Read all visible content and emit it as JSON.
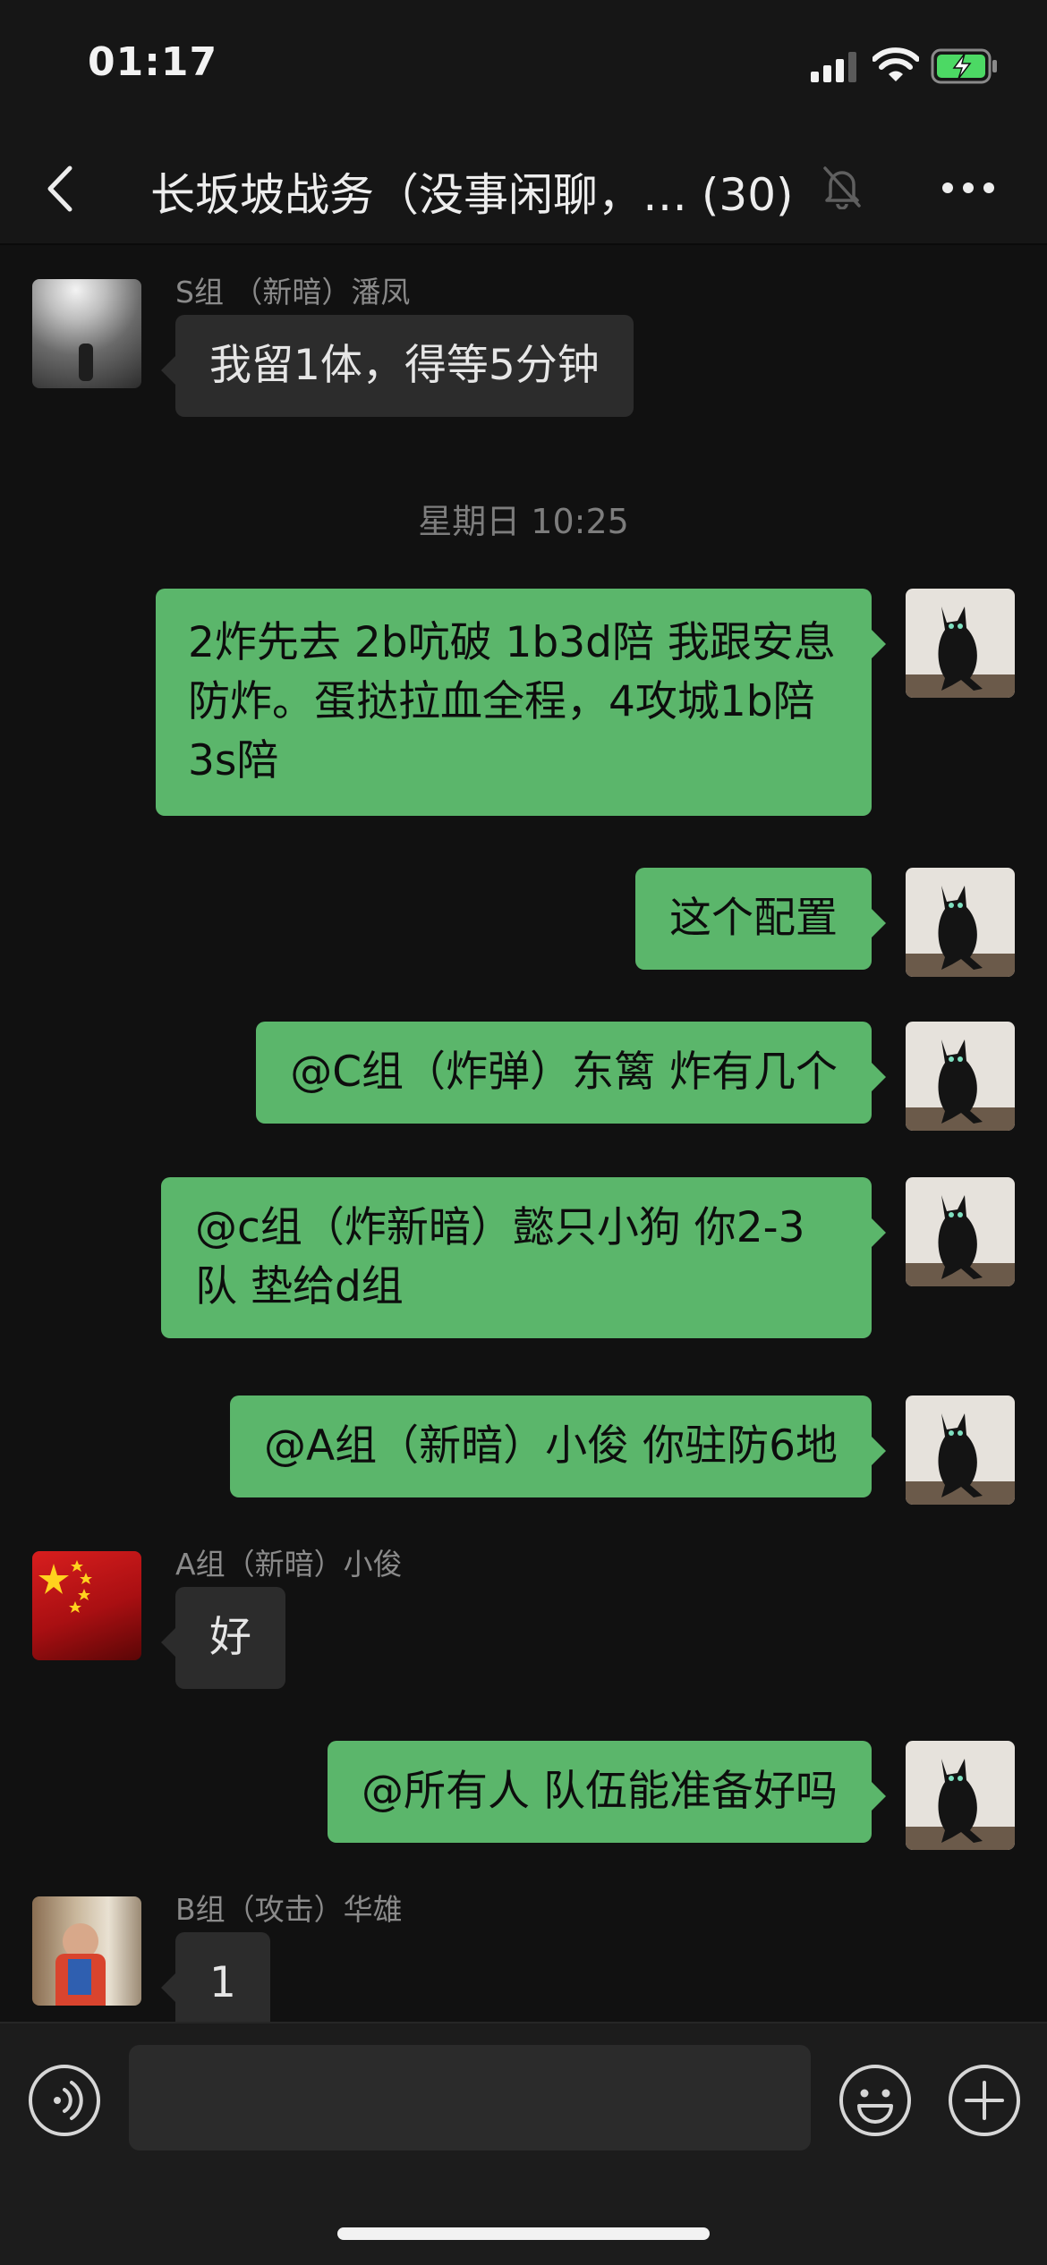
{
  "status_bar": {
    "time": "01:17",
    "signal_icon": "signal-bars-icon",
    "wifi_icon": "wifi-icon",
    "battery_icon": "battery-charging-icon"
  },
  "nav": {
    "back_icon": "chevron-left-icon",
    "title": "长坂坡战务（没事闲聊，… (30)",
    "mute_icon": "bell-slash-icon",
    "more_icon": "more-dots-icon"
  },
  "colors": {
    "background": "#111111",
    "bar": "#161616",
    "outgoing_bubble": "#5bb66b",
    "incoming_bubble": "#2c2c2c"
  },
  "messages": [
    {
      "dir": "in",
      "sender": "S组 （新暗）潘凤",
      "text": "我留1体，得等5分钟",
      "avatar": "avatar-light-room"
    },
    {
      "timestamp": "星期日 10:25"
    },
    {
      "dir": "out",
      "text": "2炸先去 2b吭破 1b3d陪 我跟安息防炸。蛋挞拉血全程，4攻城1b陪 3s陪",
      "avatar": "avatar-black-cat"
    },
    {
      "dir": "out",
      "text": "这个配置",
      "avatar": "avatar-black-cat"
    },
    {
      "dir": "out",
      "text": "@C组（炸弹）东篱 炸有几个",
      "avatar": "avatar-black-cat"
    },
    {
      "dir": "out",
      "text": "@c组（炸新暗）懿只小狗 你2-3队 垫给d组",
      "avatar": "avatar-black-cat"
    },
    {
      "dir": "out",
      "text": "@A组（新暗）小俊 你驻防6地",
      "avatar": "avatar-black-cat"
    },
    {
      "dir": "in",
      "sender": "A组（新暗）小俊",
      "text": "好",
      "avatar": "avatar-flag"
    },
    {
      "dir": "out",
      "text": "@所有人 队伍能准备好吗",
      "avatar": "avatar-black-cat"
    },
    {
      "dir": "in",
      "sender": "B组（攻击）华雄",
      "text": "1",
      "avatar": "avatar-costume"
    }
  ],
  "input_bar": {
    "voice_icon": "voice-wave-icon",
    "emoji_icon": "smiley-icon",
    "plus_icon": "plus-circle-icon",
    "placeholder": ""
  }
}
